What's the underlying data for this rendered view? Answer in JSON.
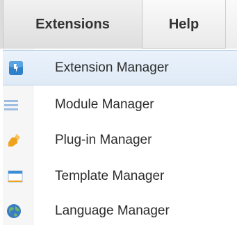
{
  "menubar": {
    "tabs": [
      {
        "label": "Extensions",
        "active": true
      },
      {
        "label": "Help",
        "active": false
      }
    ]
  },
  "dropdown": {
    "items": [
      {
        "label": "Extension Manager",
        "icon": "extension-icon",
        "highlighted": true
      },
      {
        "label": "Module Manager",
        "icon": "module-icon"
      },
      {
        "label": "Plug-in Manager",
        "icon": "plugin-icon"
      },
      {
        "label": "Template Manager",
        "icon": "template-icon"
      },
      {
        "label": "Language Manager",
        "icon": "language-globe-icon"
      }
    ]
  },
  "colors": {
    "highlight_bg": "#e3edf8",
    "extension_icon": "#2f80c8",
    "module_icon": "#7fa8d6",
    "plugin_icon": "#f0a21a",
    "template_icon": "#3b8fd4",
    "globe_icon": "#3a7cc4"
  }
}
